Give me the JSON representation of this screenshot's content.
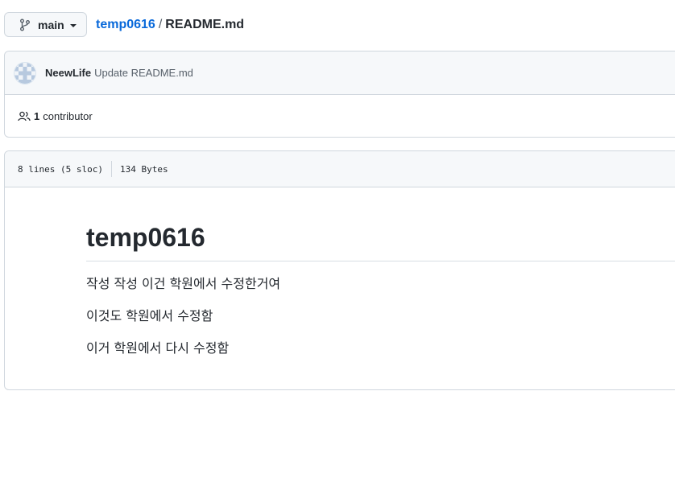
{
  "header": {
    "branch_label": "main",
    "repo_name": "temp0616",
    "separator": "/",
    "file_name": "README.md"
  },
  "commit": {
    "author": "NeewLife",
    "message": "Update README.md"
  },
  "contributors": {
    "count": "1",
    "label": "contributor"
  },
  "file": {
    "lines_info": "8 lines (5 sloc)",
    "size": "134 Bytes"
  },
  "readme": {
    "title": "temp0616",
    "paragraphs": [
      "작성 작성 이건 학원에서 수정한거여",
      "이것도 학원에서 수정함",
      "이거 학원에서 다시 수정함"
    ]
  },
  "icons": {
    "branch": "git-branch-icon",
    "caret": "caret-down-icon",
    "people": "people-icon"
  },
  "colors": {
    "link": "#0969da",
    "border": "#d0d7de",
    "header_bg": "#f6f8fa"
  }
}
